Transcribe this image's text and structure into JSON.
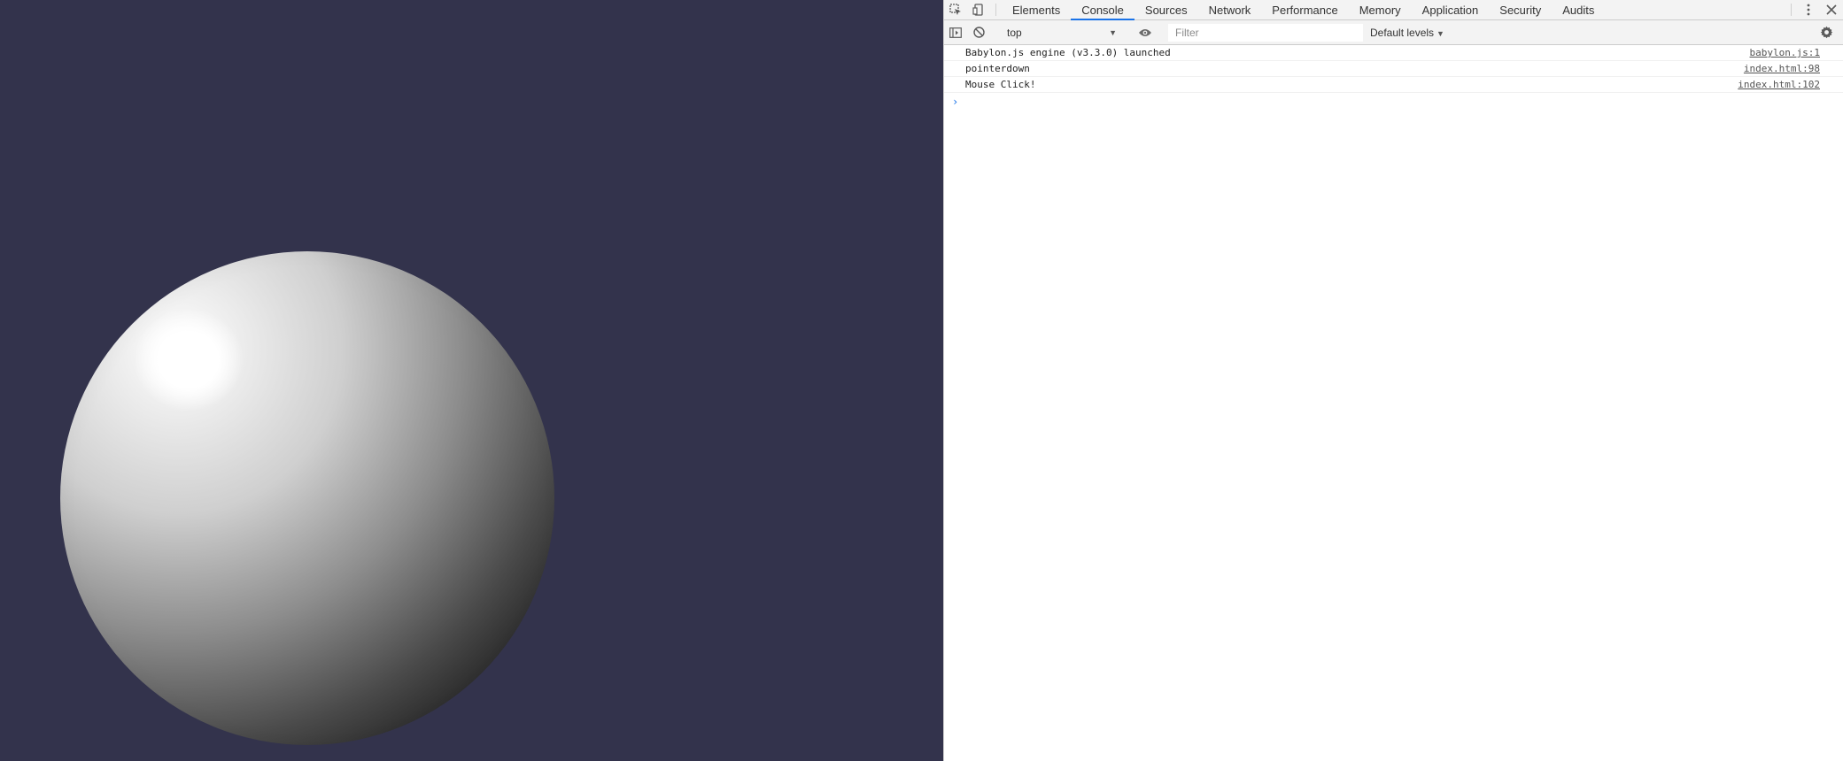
{
  "devtools": {
    "tabs": [
      {
        "label": "Elements"
      },
      {
        "label": "Console",
        "active": true
      },
      {
        "label": "Sources"
      },
      {
        "label": "Network"
      },
      {
        "label": "Performance"
      },
      {
        "label": "Memory"
      },
      {
        "label": "Application"
      },
      {
        "label": "Security"
      },
      {
        "label": "Audits"
      }
    ],
    "toolbar": {
      "context": "top",
      "filter_placeholder": "Filter",
      "levels": "Default levels"
    },
    "messages": [
      {
        "text": "Babylon.js engine (v3.3.0) launched",
        "source": "babylon.js:1"
      },
      {
        "text": "pointerdown",
        "source": "index.html:98"
      },
      {
        "text": "Mouse Click!",
        "source": "index.html:102"
      }
    ],
    "prompt_symbol": "›"
  },
  "colors": {
    "viewport_bg": "#33334c",
    "accent": "#1a73e8"
  },
  "icons": [
    "inspect-icon",
    "device-toggle-icon",
    "more-icon",
    "close-icon",
    "sidebar-toggle-icon",
    "clear-console-icon",
    "eye-icon",
    "gear-icon"
  ]
}
